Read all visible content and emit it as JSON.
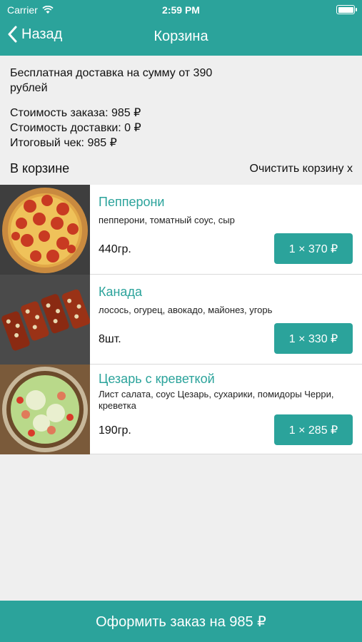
{
  "status": {
    "carrier": "Carrier",
    "time": "2:59 PM"
  },
  "nav": {
    "back_label": "Назад",
    "title": "Корзина"
  },
  "summary": {
    "free_delivery": "Бесплатная доставка на сумму от 390\n рублей",
    "order_cost": "Стоимость заказа: 985 ₽",
    "delivery_cost": "Стоимость доставки: 0 ₽",
    "total": "Итоговый чек: 985 ₽"
  },
  "cart": {
    "heading": "В корзине",
    "clear_label": "Очистить корзину x"
  },
  "items": [
    {
      "name": "Пепперони",
      "description": "пепперони, томатный соус, сыр",
      "weight": "440гр.",
      "price": "1 × 370 ₽",
      "image": "pizza-image"
    },
    {
      "name": "Канада",
      "description": "лосось, огурец, авокадо, майонез, угорь",
      "weight": "8шт.",
      "price": "1 × 330 ₽",
      "image": "rolls-image"
    },
    {
      "name": "Цезарь с креветкой",
      "description": "Лист салата, соус Цезарь, сухарики, помидоры Черри, креветка",
      "weight": "190гр.",
      "price": "1 × 285 ₽",
      "image": "salad-image"
    }
  ],
  "checkout": {
    "label": "Оформить заказ на 985 ₽"
  },
  "colors": {
    "accent": "#2ba39b",
    "background": "#efefef"
  }
}
